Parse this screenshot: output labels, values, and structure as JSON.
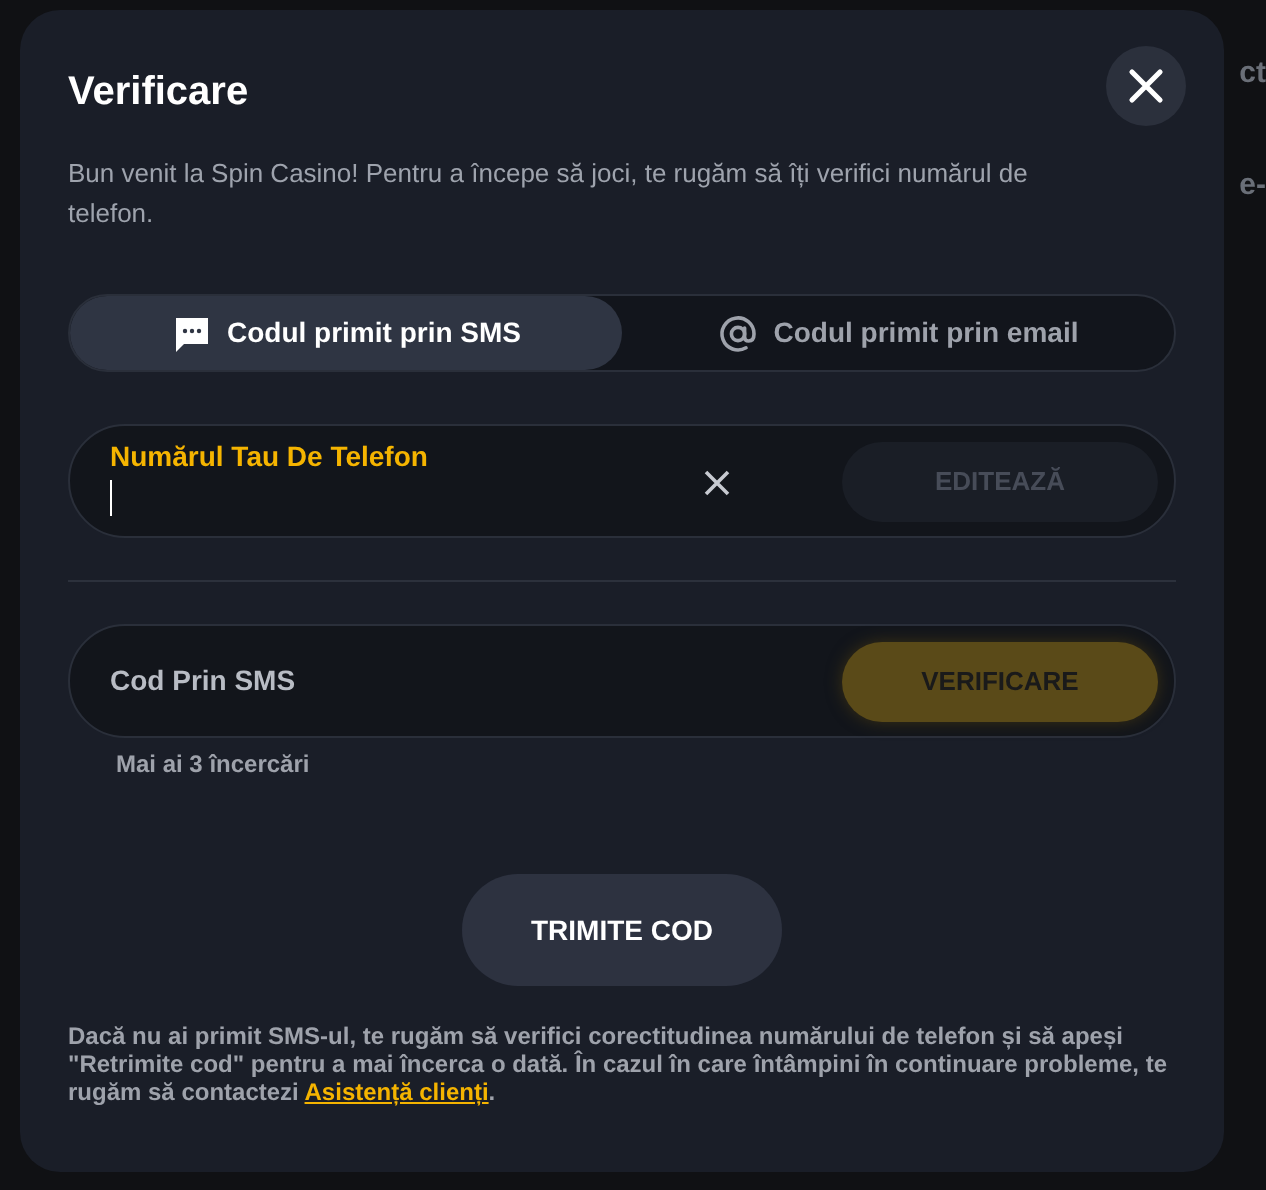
{
  "background_fragments": [
    "ct",
    "e-"
  ],
  "dialog": {
    "title": "Verificare",
    "intro": "Bun venit la Spin Casino! Pentru a începe să joci, te rugăm să îți verifici numărul de telefon.",
    "tabs": [
      {
        "label": "Codul primit prin SMS",
        "selected": true
      },
      {
        "label": "Codul primit prin email",
        "selected": false
      }
    ],
    "fields": [
      {
        "label": "Numărul Tau De Telefon",
        "focused": true,
        "clearable": true,
        "button": {
          "label": "EDITEAZĂ",
          "disabled": true
        }
      },
      {
        "label": "Cod Prin SMS",
        "focused": false,
        "clearable": false,
        "button": {
          "label": "VERIFICARE",
          "disabled": true
        },
        "hint": "Mai ai 3 încercări"
      }
    ],
    "send_button": "TRIMITE COD",
    "footer": {
      "text": "Dacă nu ai primit SMS-ul, te rugăm să verifici corectitudinea numărului de telefon și să apeși \"Retrimite cod\" pentru a mai încerca o dată. În cazul în care întâmpini în continuare probleme, te rugăm să contactezi ",
      "link": "Asistență clienți",
      "after": "."
    }
  }
}
